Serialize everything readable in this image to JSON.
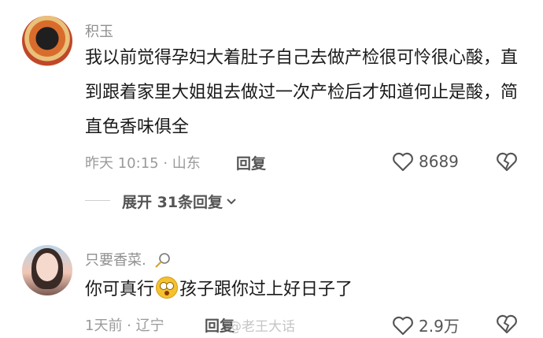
{
  "comments": [
    {
      "username": "积玉",
      "text": "我以前觉得孕妇大着肚子自己去做产检很可怜很心酸，直到跟着家里大姐姐去做过一次产检后才知道何止是酸，简直色香味俱全",
      "meta": "昨天 10:15 · 山东",
      "reply_label": "回复",
      "likes": "8689",
      "expand_replies": "展开 31条回复"
    },
    {
      "username": "只要香菜.",
      "text_before": "你可真行",
      "text_after": "孩子跟你过上好日子了",
      "meta": "1天前 · 辽宁",
      "reply_label": "回复",
      "likes": "2.9万"
    }
  ],
  "watermark": "@老王大话",
  "icons": [
    "heart-outline-icon",
    "dislike-heart-icon",
    "chevron-down-icon",
    "badminton-racket-icon",
    "flushed-face-emoji"
  ]
}
